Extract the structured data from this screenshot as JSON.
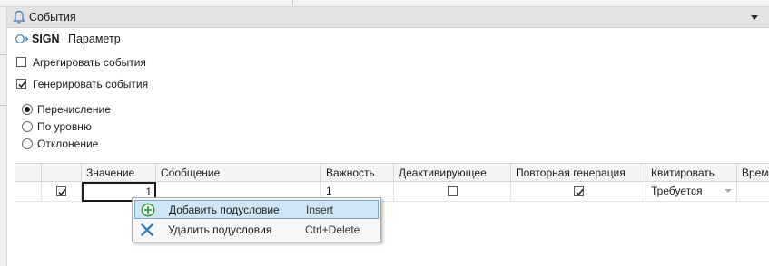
{
  "panel": {
    "title": "События",
    "sign_label": "SIGN",
    "param_label": "Параметр"
  },
  "options": {
    "aggregate": {
      "label": "Агрегировать события",
      "checked": false
    },
    "generate": {
      "label": "Генерировать события",
      "checked": true
    }
  },
  "mode": {
    "items": [
      {
        "label": "Перечисление",
        "selected": true
      },
      {
        "label": "По уровню",
        "selected": false
      },
      {
        "label": "Отклонение",
        "selected": false
      }
    ]
  },
  "grid": {
    "columns": [
      "Значение",
      "Сообщение",
      "Важность",
      "Деактивирующее",
      "Повторная генерация",
      "Квитировать",
      "Время"
    ],
    "row": {
      "enabled": true,
      "value": "1",
      "message": "",
      "severity": "1",
      "deactivating": false,
      "regenerate": true,
      "acknowledge": "Требуется"
    }
  },
  "context_menu": {
    "items": [
      {
        "label": "Добавить подусловие",
        "shortcut": "Insert",
        "icon": "add-circle-icon",
        "highlighted": true
      },
      {
        "label": "Удалить подусловия",
        "shortcut": "Ctrl+Delete",
        "icon": "delete-x-icon",
        "highlighted": false
      }
    ]
  },
  "colors": {
    "header_bg": "#e3e3e3",
    "menu_highlight": "#cfe4f4",
    "add_icon": "#2e9a3e",
    "delete_icon": "#3a7fc4"
  }
}
